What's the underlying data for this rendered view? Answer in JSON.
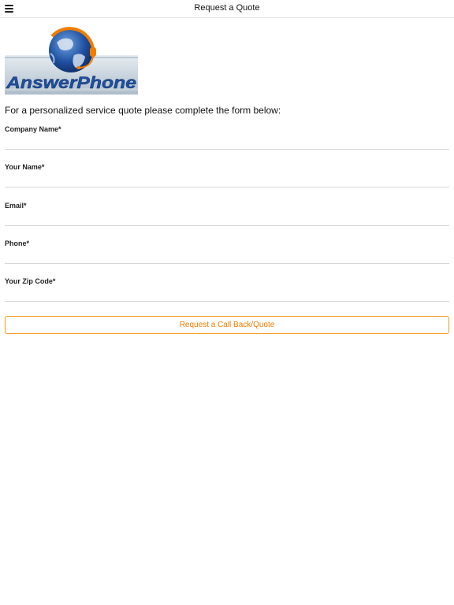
{
  "header": {
    "title": "Request a Quote",
    "menu_icon": "hamburger-menu-icon"
  },
  "logo": {
    "brand_text": "AnswerPhone",
    "icon": "globe-headset-icon",
    "colors": {
      "blue": "#1f4fa0",
      "orange": "#f07d00",
      "silver": "#c9d3db"
    }
  },
  "intro_text": "For a personalized service quote please complete the form below:",
  "form": {
    "fields": [
      {
        "label": "Company Name*",
        "value": ""
      },
      {
        "label": "Your Name*",
        "value": ""
      },
      {
        "label": "Email*",
        "value": ""
      },
      {
        "label": "Phone*",
        "value": ""
      },
      {
        "label": "Your Zip Code*",
        "value": ""
      }
    ],
    "submit_label": "Request a Call Back/Quote"
  },
  "colors": {
    "accent": "#f07d00",
    "divider": "#d6d6d6",
    "text": "#111111"
  }
}
